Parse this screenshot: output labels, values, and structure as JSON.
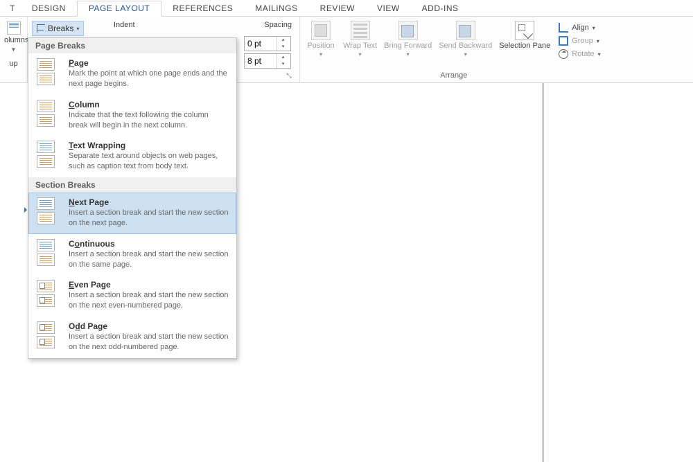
{
  "tabs": {
    "t0": "T",
    "design": "DESIGN",
    "pagelayout": "PAGE LAYOUT",
    "references": "REFERENCES",
    "mailings": "MAILINGS",
    "review": "REVIEW",
    "view": "VIEW",
    "addins": "ADD-INS"
  },
  "ribbon": {
    "columns_label": "olumns",
    "columns_sub": "up",
    "breaks_label": "Breaks",
    "indent_label": "Indent",
    "spacing_label": "Spacing",
    "spacing_before": "0 pt",
    "spacing_after": "8 pt",
    "arrange_label": "Arrange",
    "position": "Position",
    "wrap": "Wrap Text",
    "bring": "Bring Forward",
    "send": "Send Backward",
    "selpane": "Selection Pane",
    "align": "Align",
    "group": "Group",
    "rotate": "Rotate"
  },
  "menu": {
    "page_breaks_hdr": "Page Breaks",
    "section_breaks_hdr": "Section Breaks",
    "items": {
      "page": {
        "title": "Page",
        "desc": "Mark the point at which one page ends and the next page begins."
      },
      "column": {
        "title": "Column",
        "desc": "Indicate that the text following the column break will begin in the next column."
      },
      "textwrap": {
        "title": "Text Wrapping",
        "desc": "Separate text around objects on web pages, such as caption text from body text."
      },
      "nextpage": {
        "title": "Next Page",
        "desc": "Insert a section break and start the new section on the next page."
      },
      "continuous": {
        "title": "Continuous",
        "desc": "Insert a section break and start the new section on the same page."
      },
      "evenpage": {
        "title": "Even Page",
        "desc": "Insert a section break and start the new section on the next even-numbered page."
      },
      "oddpage": {
        "title": "Odd Page",
        "desc": "Insert a section break and start the new section on the next odd-numbered page."
      }
    }
  }
}
